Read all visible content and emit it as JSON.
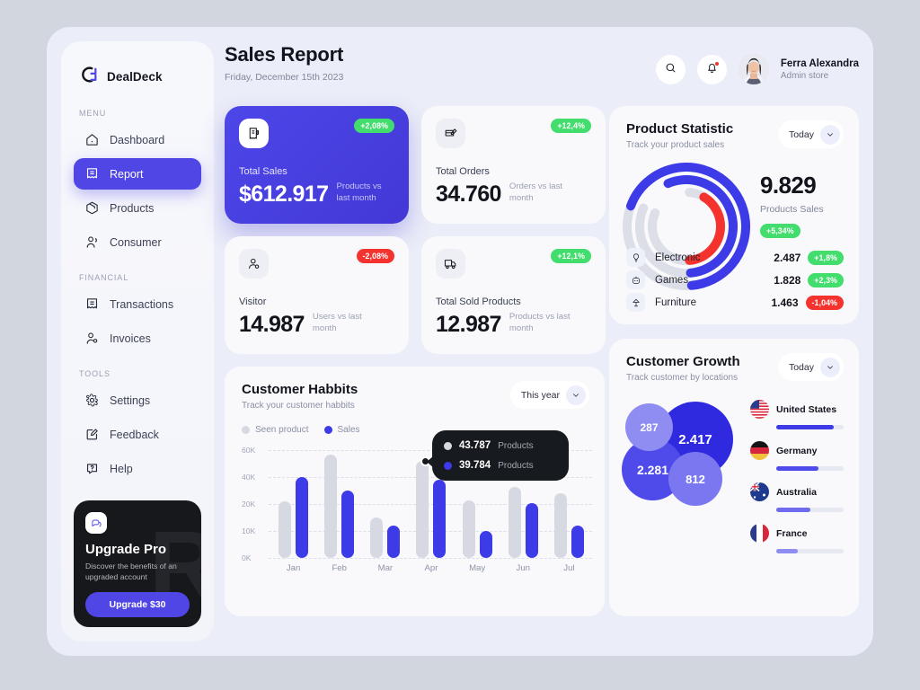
{
  "brand": {
    "name": "DealDeck",
    "logo_icon": "dealdeck-logo-icon"
  },
  "sidebar": {
    "groups": [
      {
        "label": "MENU",
        "items": [
          {
            "label": "Dashboard",
            "icon": "home-icon",
            "active": false
          },
          {
            "label": "Report",
            "icon": "report-icon",
            "active": true
          },
          {
            "label": "Products",
            "icon": "box-icon",
            "active": false
          },
          {
            "label": "Consumer",
            "icon": "users-icon",
            "active": false
          }
        ]
      },
      {
        "label": "FINANCIAL",
        "items": [
          {
            "label": "Transactions",
            "icon": "receipt-icon",
            "active": false
          },
          {
            "label": "Invoices",
            "icon": "invoice-user-icon",
            "active": false
          }
        ]
      },
      {
        "label": "TOOLS",
        "items": [
          {
            "label": "Settings",
            "icon": "gear-icon",
            "active": false
          },
          {
            "label": "Feedback",
            "icon": "edit-square-icon",
            "active": false
          },
          {
            "label": "Help",
            "icon": "help-icon",
            "active": false
          }
        ]
      }
    ],
    "upgrade": {
      "icon": "chat-bubbles-icon",
      "watermark": "R",
      "title": "Upgrade Pro",
      "subtitle": "Discover the benefits of an upgraded account",
      "button_label": "Upgrade $30"
    }
  },
  "header": {
    "title": "Sales Report",
    "date": "Friday, December 15th 2023",
    "search_icon": "search-icon",
    "notification_icon": "bell-icon",
    "has_notification": true,
    "user": {
      "name": "Ferra Alexandra",
      "role": "Admin store",
      "avatar": "user-avatar"
    }
  },
  "stats": [
    {
      "label": "Total Sales",
      "value": "$612.917",
      "compare": "Products vs last month",
      "badge": "+2,08%",
      "trend": "up",
      "icon": "sales-receipt-icon",
      "primary": true
    },
    {
      "label": "Total Orders",
      "value": "34.760",
      "compare": "Orders vs last month",
      "badge": "+12,4%",
      "trend": "up",
      "icon": "order-edit-icon",
      "primary": false
    },
    {
      "label": "Visitor",
      "value": "14.987",
      "compare": "Users vs last month",
      "badge": "-2,08%",
      "trend": "down",
      "icon": "visitor-icon",
      "primary": false
    },
    {
      "label": "Total Sold Products",
      "value": "12.987",
      "compare": "Products vs last month",
      "badge": "+12,1%",
      "trend": "up",
      "icon": "truck-icon",
      "primary": false
    }
  ],
  "habits": {
    "title": "Customer Habbits",
    "subtitle": "Track your customer habbits",
    "filter": "This year",
    "filter_icon": "chevron-down-icon",
    "tooltip": [
      {
        "value": "43.787",
        "unit": "Products",
        "color": "#d6d8e2"
      },
      {
        "value": "39.784",
        "unit": "Products",
        "color": "#3d3ae8"
      }
    ]
  },
  "product_statistic": {
    "title": "Product Statistic",
    "subtitle": "Track your product sales",
    "filter": "Today",
    "filter_icon": "chevron-down-icon",
    "total": "9.829",
    "total_label": "Products Sales",
    "total_badge": "+5,34%",
    "rings": [
      {
        "name": "Electronic",
        "color": "#3d3ae8",
        "percent": 68
      },
      {
        "name": "Games",
        "color": "#3d3ae8",
        "percent": 55
      },
      {
        "name": "Furniture",
        "color": "#f5332e",
        "percent": 40
      }
    ],
    "items": [
      {
        "name": "Electronic",
        "value": "2.487",
        "badge": "+1,8%",
        "trend": "up",
        "icon": "bulb-icon"
      },
      {
        "name": "Games",
        "value": "1.828",
        "badge": "+2,3%",
        "trend": "up",
        "icon": "robot-icon"
      },
      {
        "name": "Furniture",
        "value": "1.463",
        "badge": "-1,04%",
        "trend": "down",
        "icon": "lamp-icon"
      }
    ]
  },
  "customer_growth": {
    "title": "Customer Growth",
    "subtitle": "Track customer by locations",
    "filter": "Today",
    "filter_icon": "chevron-down-icon",
    "bubbles": [
      {
        "value": "2.417",
        "size": 84,
        "x": 40,
        "y": 4,
        "color": "#2f2ae0",
        "font": 15
      },
      {
        "value": "2.281",
        "size": 69,
        "x": 0,
        "y": 45,
        "color": "#4f4aea",
        "font": 14
      },
      {
        "value": "812",
        "size": 60,
        "x": 52,
        "y": 60,
        "color": "#7b77f0",
        "font": 13
      },
      {
        "value": "287",
        "size": 53,
        "x": 4,
        "y": 6,
        "color": "#8f8cf2",
        "font": 12
      }
    ],
    "countries": [
      {
        "name": "United States",
        "flag": "us-flag-icon",
        "percent": 85,
        "color": "#3d3ae8"
      },
      {
        "name": "Germany",
        "flag": "de-flag-icon",
        "percent": 62,
        "color": "#4f4aea"
      },
      {
        "name": "Australia",
        "flag": "au-flag-icon",
        "percent": 50,
        "color": "#6f6bee"
      },
      {
        "name": "France",
        "flag": "fr-flag-icon",
        "percent": 32,
        "color": "#8f8cf2"
      }
    ]
  },
  "chart_data": {
    "type": "bar",
    "title": "Customer Habbits",
    "subtitle": "Track your customer habbits",
    "xlabel": "",
    "ylabel": "",
    "categories": [
      "Jan",
      "Feb",
      "Mar",
      "Apr",
      "May",
      "Jun",
      "Jul"
    ],
    "ytick_labels": [
      "60K",
      "40K",
      "20K",
      "10K",
      "0K"
    ],
    "ylim": [
      0,
      60000
    ],
    "grid": true,
    "legend_position": "top-left",
    "series": [
      {
        "name": "Seen product",
        "color": "#d6d8e2",
        "values": [
          22000,
          57000,
          15000,
          52000,
          23000,
          33000,
          28000
        ]
      },
      {
        "name": "Sales",
        "color": "#3d3ae8",
        "values": [
          40000,
          30000,
          12000,
          38000,
          10000,
          21000,
          12000
        ]
      }
    ]
  }
}
